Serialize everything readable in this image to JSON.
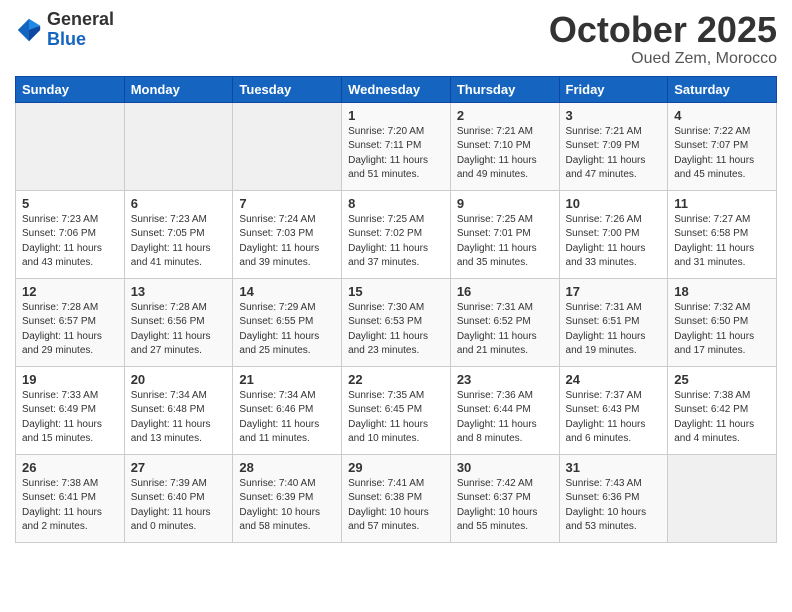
{
  "header": {
    "logo_general": "General",
    "logo_blue": "Blue",
    "month": "October 2025",
    "location": "Oued Zem, Morocco"
  },
  "days_of_week": [
    "Sunday",
    "Monday",
    "Tuesday",
    "Wednesday",
    "Thursday",
    "Friday",
    "Saturday"
  ],
  "weeks": [
    [
      {
        "day": "",
        "info": ""
      },
      {
        "day": "",
        "info": ""
      },
      {
        "day": "",
        "info": ""
      },
      {
        "day": "1",
        "info": "Sunrise: 7:20 AM\nSunset: 7:11 PM\nDaylight: 11 hours\nand 51 minutes."
      },
      {
        "day": "2",
        "info": "Sunrise: 7:21 AM\nSunset: 7:10 PM\nDaylight: 11 hours\nand 49 minutes."
      },
      {
        "day": "3",
        "info": "Sunrise: 7:21 AM\nSunset: 7:09 PM\nDaylight: 11 hours\nand 47 minutes."
      },
      {
        "day": "4",
        "info": "Sunrise: 7:22 AM\nSunset: 7:07 PM\nDaylight: 11 hours\nand 45 minutes."
      }
    ],
    [
      {
        "day": "5",
        "info": "Sunrise: 7:23 AM\nSunset: 7:06 PM\nDaylight: 11 hours\nand 43 minutes."
      },
      {
        "day": "6",
        "info": "Sunrise: 7:23 AM\nSunset: 7:05 PM\nDaylight: 11 hours\nand 41 minutes."
      },
      {
        "day": "7",
        "info": "Sunrise: 7:24 AM\nSunset: 7:03 PM\nDaylight: 11 hours\nand 39 minutes."
      },
      {
        "day": "8",
        "info": "Sunrise: 7:25 AM\nSunset: 7:02 PM\nDaylight: 11 hours\nand 37 minutes."
      },
      {
        "day": "9",
        "info": "Sunrise: 7:25 AM\nSunset: 7:01 PM\nDaylight: 11 hours\nand 35 minutes."
      },
      {
        "day": "10",
        "info": "Sunrise: 7:26 AM\nSunset: 7:00 PM\nDaylight: 11 hours\nand 33 minutes."
      },
      {
        "day": "11",
        "info": "Sunrise: 7:27 AM\nSunset: 6:58 PM\nDaylight: 11 hours\nand 31 minutes."
      }
    ],
    [
      {
        "day": "12",
        "info": "Sunrise: 7:28 AM\nSunset: 6:57 PM\nDaylight: 11 hours\nand 29 minutes."
      },
      {
        "day": "13",
        "info": "Sunrise: 7:28 AM\nSunset: 6:56 PM\nDaylight: 11 hours\nand 27 minutes."
      },
      {
        "day": "14",
        "info": "Sunrise: 7:29 AM\nSunset: 6:55 PM\nDaylight: 11 hours\nand 25 minutes."
      },
      {
        "day": "15",
        "info": "Sunrise: 7:30 AM\nSunset: 6:53 PM\nDaylight: 11 hours\nand 23 minutes."
      },
      {
        "day": "16",
        "info": "Sunrise: 7:31 AM\nSunset: 6:52 PM\nDaylight: 11 hours\nand 21 minutes."
      },
      {
        "day": "17",
        "info": "Sunrise: 7:31 AM\nSunset: 6:51 PM\nDaylight: 11 hours\nand 19 minutes."
      },
      {
        "day": "18",
        "info": "Sunrise: 7:32 AM\nSunset: 6:50 PM\nDaylight: 11 hours\nand 17 minutes."
      }
    ],
    [
      {
        "day": "19",
        "info": "Sunrise: 7:33 AM\nSunset: 6:49 PM\nDaylight: 11 hours\nand 15 minutes."
      },
      {
        "day": "20",
        "info": "Sunrise: 7:34 AM\nSunset: 6:48 PM\nDaylight: 11 hours\nand 13 minutes."
      },
      {
        "day": "21",
        "info": "Sunrise: 7:34 AM\nSunset: 6:46 PM\nDaylight: 11 hours\nand 11 minutes."
      },
      {
        "day": "22",
        "info": "Sunrise: 7:35 AM\nSunset: 6:45 PM\nDaylight: 11 hours\nand 10 minutes."
      },
      {
        "day": "23",
        "info": "Sunrise: 7:36 AM\nSunset: 6:44 PM\nDaylight: 11 hours\nand 8 minutes."
      },
      {
        "day": "24",
        "info": "Sunrise: 7:37 AM\nSunset: 6:43 PM\nDaylight: 11 hours\nand 6 minutes."
      },
      {
        "day": "25",
        "info": "Sunrise: 7:38 AM\nSunset: 6:42 PM\nDaylight: 11 hours\nand 4 minutes."
      }
    ],
    [
      {
        "day": "26",
        "info": "Sunrise: 7:38 AM\nSunset: 6:41 PM\nDaylight: 11 hours\nand 2 minutes."
      },
      {
        "day": "27",
        "info": "Sunrise: 7:39 AM\nSunset: 6:40 PM\nDaylight: 11 hours\nand 0 minutes."
      },
      {
        "day": "28",
        "info": "Sunrise: 7:40 AM\nSunset: 6:39 PM\nDaylight: 10 hours\nand 58 minutes."
      },
      {
        "day": "29",
        "info": "Sunrise: 7:41 AM\nSunset: 6:38 PM\nDaylight: 10 hours\nand 57 minutes."
      },
      {
        "day": "30",
        "info": "Sunrise: 7:42 AM\nSunset: 6:37 PM\nDaylight: 10 hours\nand 55 minutes."
      },
      {
        "day": "31",
        "info": "Sunrise: 7:43 AM\nSunset: 6:36 PM\nDaylight: 10 hours\nand 53 minutes."
      },
      {
        "day": "",
        "info": ""
      }
    ]
  ]
}
